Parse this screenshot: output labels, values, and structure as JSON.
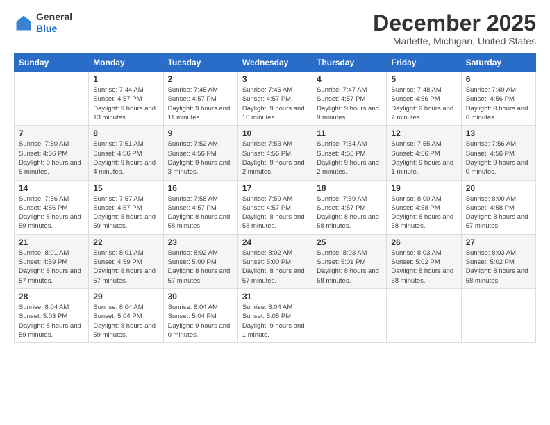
{
  "header": {
    "logo_general": "General",
    "logo_blue": "Blue",
    "month_title": "December 2025",
    "location": "Marlette, Michigan, United States"
  },
  "weekdays": [
    "Sunday",
    "Monday",
    "Tuesday",
    "Wednesday",
    "Thursday",
    "Friday",
    "Saturday"
  ],
  "weeks": [
    [
      {
        "day": "",
        "sunrise": "",
        "sunset": "",
        "daylight": ""
      },
      {
        "day": "1",
        "sunrise": "Sunrise: 7:44 AM",
        "sunset": "Sunset: 4:57 PM",
        "daylight": "Daylight: 9 hours and 13 minutes."
      },
      {
        "day": "2",
        "sunrise": "Sunrise: 7:45 AM",
        "sunset": "Sunset: 4:57 PM",
        "daylight": "Daylight: 9 hours and 11 minutes."
      },
      {
        "day": "3",
        "sunrise": "Sunrise: 7:46 AM",
        "sunset": "Sunset: 4:57 PM",
        "daylight": "Daylight: 9 hours and 10 minutes."
      },
      {
        "day": "4",
        "sunrise": "Sunrise: 7:47 AM",
        "sunset": "Sunset: 4:57 PM",
        "daylight": "Daylight: 9 hours and 9 minutes."
      },
      {
        "day": "5",
        "sunrise": "Sunrise: 7:48 AM",
        "sunset": "Sunset: 4:56 PM",
        "daylight": "Daylight: 9 hours and 7 minutes."
      },
      {
        "day": "6",
        "sunrise": "Sunrise: 7:49 AM",
        "sunset": "Sunset: 4:56 PM",
        "daylight": "Daylight: 9 hours and 6 minutes."
      }
    ],
    [
      {
        "day": "7",
        "sunrise": "Sunrise: 7:50 AM",
        "sunset": "Sunset: 4:56 PM",
        "daylight": "Daylight: 9 hours and 5 minutes."
      },
      {
        "day": "8",
        "sunrise": "Sunrise: 7:51 AM",
        "sunset": "Sunset: 4:56 PM",
        "daylight": "Daylight: 9 hours and 4 minutes."
      },
      {
        "day": "9",
        "sunrise": "Sunrise: 7:52 AM",
        "sunset": "Sunset: 4:56 PM",
        "daylight": "Daylight: 9 hours and 3 minutes."
      },
      {
        "day": "10",
        "sunrise": "Sunrise: 7:53 AM",
        "sunset": "Sunset: 4:56 PM",
        "daylight": "Daylight: 9 hours and 2 minutes."
      },
      {
        "day": "11",
        "sunrise": "Sunrise: 7:54 AM",
        "sunset": "Sunset: 4:56 PM",
        "daylight": "Daylight: 9 hours and 2 minutes."
      },
      {
        "day": "12",
        "sunrise": "Sunrise: 7:55 AM",
        "sunset": "Sunset: 4:56 PM",
        "daylight": "Daylight: 9 hours and 1 minute."
      },
      {
        "day": "13",
        "sunrise": "Sunrise: 7:56 AM",
        "sunset": "Sunset: 4:56 PM",
        "daylight": "Daylight: 9 hours and 0 minutes."
      }
    ],
    [
      {
        "day": "14",
        "sunrise": "Sunrise: 7:56 AM",
        "sunset": "Sunset: 4:56 PM",
        "daylight": "Daylight: 8 hours and 59 minutes."
      },
      {
        "day": "15",
        "sunrise": "Sunrise: 7:57 AM",
        "sunset": "Sunset: 4:57 PM",
        "daylight": "Daylight: 8 hours and 59 minutes."
      },
      {
        "day": "16",
        "sunrise": "Sunrise: 7:58 AM",
        "sunset": "Sunset: 4:57 PM",
        "daylight": "Daylight: 8 hours and 58 minutes."
      },
      {
        "day": "17",
        "sunrise": "Sunrise: 7:59 AM",
        "sunset": "Sunset: 4:57 PM",
        "daylight": "Daylight: 8 hours and 58 minutes."
      },
      {
        "day": "18",
        "sunrise": "Sunrise: 7:59 AM",
        "sunset": "Sunset: 4:57 PM",
        "daylight": "Daylight: 8 hours and 58 minutes."
      },
      {
        "day": "19",
        "sunrise": "Sunrise: 8:00 AM",
        "sunset": "Sunset: 4:58 PM",
        "daylight": "Daylight: 8 hours and 58 minutes."
      },
      {
        "day": "20",
        "sunrise": "Sunrise: 8:00 AM",
        "sunset": "Sunset: 4:58 PM",
        "daylight": "Daylight: 8 hours and 57 minutes."
      }
    ],
    [
      {
        "day": "21",
        "sunrise": "Sunrise: 8:01 AM",
        "sunset": "Sunset: 4:59 PM",
        "daylight": "Daylight: 8 hours and 57 minutes."
      },
      {
        "day": "22",
        "sunrise": "Sunrise: 8:01 AM",
        "sunset": "Sunset: 4:59 PM",
        "daylight": "Daylight: 8 hours and 57 minutes."
      },
      {
        "day": "23",
        "sunrise": "Sunrise: 8:02 AM",
        "sunset": "Sunset: 5:00 PM",
        "daylight": "Daylight: 8 hours and 57 minutes."
      },
      {
        "day": "24",
        "sunrise": "Sunrise: 8:02 AM",
        "sunset": "Sunset: 5:00 PM",
        "daylight": "Daylight: 8 hours and 57 minutes."
      },
      {
        "day": "25",
        "sunrise": "Sunrise: 8:03 AM",
        "sunset": "Sunset: 5:01 PM",
        "daylight": "Daylight: 8 hours and 58 minutes."
      },
      {
        "day": "26",
        "sunrise": "Sunrise: 8:03 AM",
        "sunset": "Sunset: 5:02 PM",
        "daylight": "Daylight: 8 hours and 58 minutes."
      },
      {
        "day": "27",
        "sunrise": "Sunrise: 8:03 AM",
        "sunset": "Sunset: 5:02 PM",
        "daylight": "Daylight: 8 hours and 58 minutes."
      }
    ],
    [
      {
        "day": "28",
        "sunrise": "Sunrise: 8:04 AM",
        "sunset": "Sunset: 5:03 PM",
        "daylight": "Daylight: 8 hours and 59 minutes."
      },
      {
        "day": "29",
        "sunrise": "Sunrise: 8:04 AM",
        "sunset": "Sunset: 5:04 PM",
        "daylight": "Daylight: 8 hours and 59 minutes."
      },
      {
        "day": "30",
        "sunrise": "Sunrise: 8:04 AM",
        "sunset": "Sunset: 5:04 PM",
        "daylight": "Daylight: 9 hours and 0 minutes."
      },
      {
        "day": "31",
        "sunrise": "Sunrise: 8:04 AM",
        "sunset": "Sunset: 5:05 PM",
        "daylight": "Daylight: 9 hours and 1 minute."
      },
      {
        "day": "",
        "sunrise": "",
        "sunset": "",
        "daylight": ""
      },
      {
        "day": "",
        "sunrise": "",
        "sunset": "",
        "daylight": ""
      },
      {
        "day": "",
        "sunrise": "",
        "sunset": "",
        "daylight": ""
      }
    ]
  ]
}
